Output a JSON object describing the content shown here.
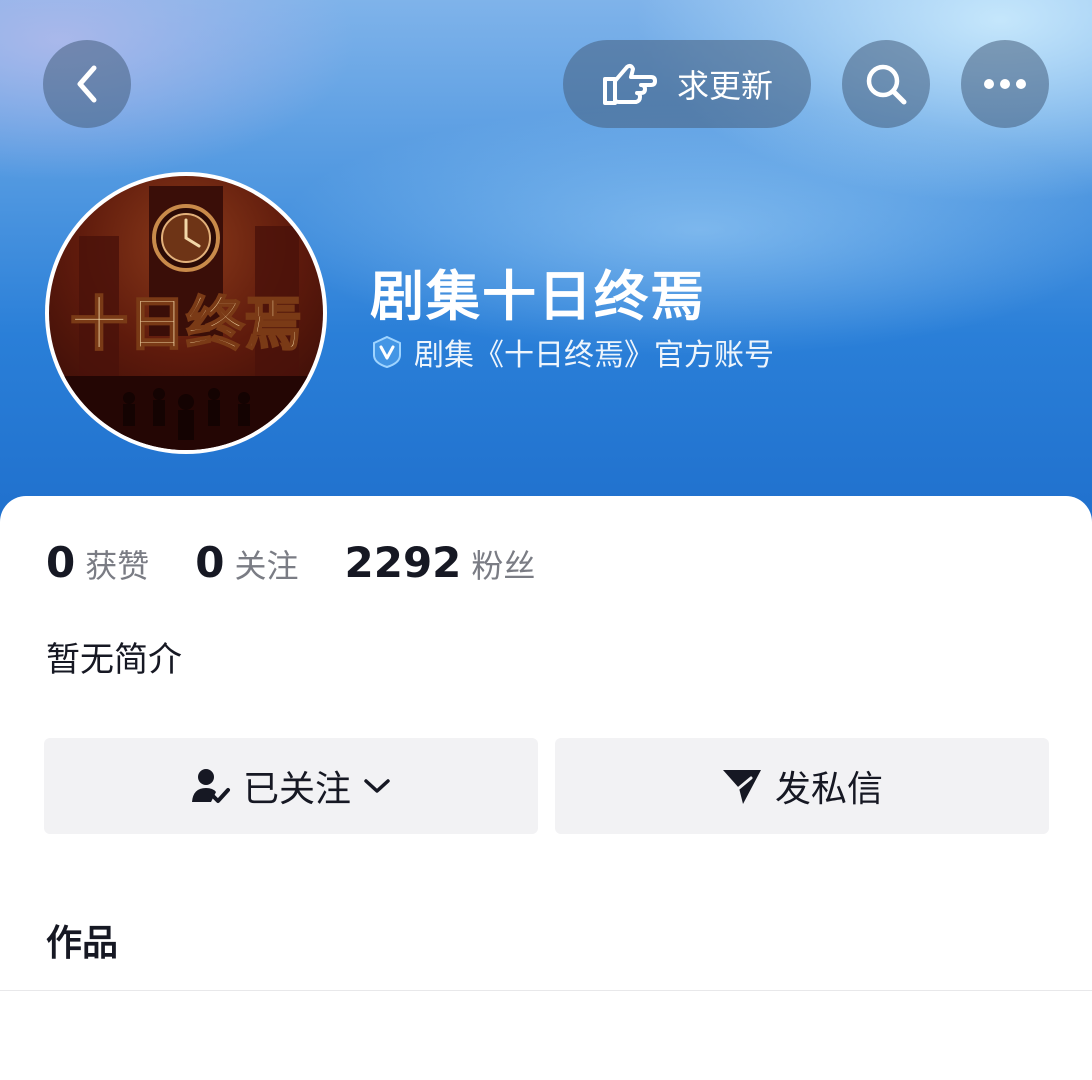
{
  "topbar": {
    "request_update_label": "求更新"
  },
  "profile": {
    "name": "剧集十日终焉",
    "verified_text": "剧集《十日终焉》官方账号",
    "avatar_text": "十日终焉"
  },
  "stats": [
    {
      "value": "0",
      "label": "获赞"
    },
    {
      "value": "0",
      "label": "关注"
    },
    {
      "value": "2292",
      "label": "粉丝"
    }
  ],
  "bio": "暂无简介",
  "actions": {
    "follow_label": "已关注",
    "message_label": "发私信"
  },
  "tabs": {
    "works_label": "作品"
  },
  "colors": {
    "header_blue": "#1f6fcc",
    "text_primary": "#161823",
    "text_secondary": "#7a7c84",
    "button_bg": "#f2f2f4"
  }
}
